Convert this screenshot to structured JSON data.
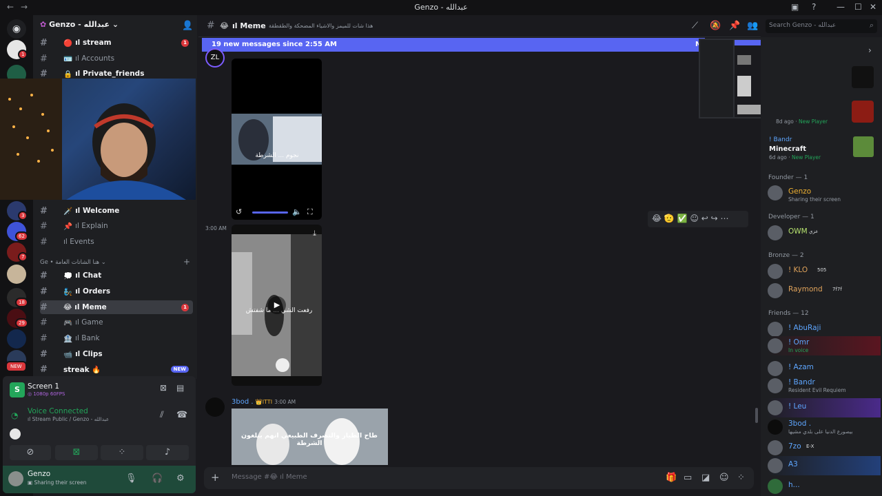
{
  "window": {
    "title": "Genzo - عبدالله"
  },
  "search": {
    "placeholder": "Search Genzo - عبدالله"
  },
  "guild": {
    "name": "Genzo - عبدالله"
  },
  "server_badges": [
    "1",
    "3",
    "62",
    "7",
    "18",
    "29",
    "NEW"
  ],
  "channels_top": [
    {
      "name": "stream",
      "emoji": "🔴",
      "unread": true,
      "count": "1"
    },
    {
      "name": "Accounts",
      "emoji": "🪪",
      "unread": false
    },
    {
      "name": "Private_friends",
      "emoji": "🔒",
      "unread": true
    }
  ],
  "channels_mid": [
    {
      "name": "Welcome",
      "emoji": "🗡️",
      "unread": true
    },
    {
      "name": "Explain",
      "emoji": "📌",
      "unread": false
    },
    {
      "name": "Events",
      "emoji": "",
      "unread": false
    }
  ],
  "category": {
    "name": "Ge • هنا الشاتات العامة"
  },
  "channels_bottom": [
    {
      "name": "Chat",
      "emoji": "💭",
      "unread": true
    },
    {
      "name": "Orders",
      "emoji": "🧞",
      "unread": true
    },
    {
      "name": "Meme",
      "emoji": "😂",
      "active": true,
      "count": "1"
    },
    {
      "name": "Game",
      "emoji": "🎮",
      "unread": false
    },
    {
      "name": "Bank",
      "emoji": "🏦",
      "unread": false
    },
    {
      "name": "Clips",
      "emoji": "📹",
      "unread": true
    },
    {
      "name": "streak",
      "emoji": "🔥",
      "unread": true,
      "badge": "NEW"
    }
  ],
  "stream_panel": {
    "title": "Screen 1",
    "quality": "1080p 60FPS"
  },
  "voice": {
    "status": "Voice Connected",
    "channel": "Stream Public / Genzo - عبدالله"
  },
  "user": {
    "name": "Genzo",
    "status": "Sharing their screen"
  },
  "chat_header": {
    "channel": "ıl Meme",
    "emoji": "😂",
    "topic": "هذا شات للميمز والاشياء المضحكة والطقطقة"
  },
  "banner": {
    "text": "19 new messages since 2:55 AM",
    "mark_label": "M"
  },
  "messages": [
    {
      "time": "3:00 AM"
    },
    {
      "author": "3bod .",
      "tag": "ITTI",
      "time": "3:00 AM",
      "caption": "طاح الطيار والتصرف الطبيعي انهم يبلغون الشرطة"
    }
  ],
  "video1_caption": "نجوم ... الشرطة",
  "video2_caption": "رفعت الشي ... ما شفتش",
  "reactions": [
    "😂",
    "🫡",
    "✅"
  ],
  "composer": {
    "placeholder": "Message #😂 ıl Meme"
  },
  "activity": [
    {
      "ago": "8d ago",
      "tag": "New Player"
    },
    {
      "name": "! Bandr",
      "game": "Minecraft",
      "ago": "6d ago",
      "tag": "New Player"
    }
  ],
  "member_groups": [
    {
      "label": "Founder — 1",
      "members": [
        {
          "name": "Genzo",
          "status": "Sharing their screen",
          "color": "#f0b232"
        }
      ]
    },
    {
      "label": "Developer — 1",
      "members": [
        {
          "name": "OWM",
          "status": "",
          "color": "#b7e36f",
          "tag": "عزي"
        }
      ]
    },
    {
      "label": "Bronze — 2",
      "members": [
        {
          "name": "! KLO",
          "status": "",
          "color": "#e0a35b",
          "tag": "505"
        },
        {
          "name": "Raymond",
          "status": "",
          "color": "#e0a35b",
          "tag": "7f7f"
        }
      ]
    },
    {
      "label": "Friends — 12",
      "members": [
        {
          "name": "! AbuRaji",
          "status": "",
          "color": "#5ea6ff"
        },
        {
          "name": "! Omr",
          "status": "In voice",
          "color": "#5ea6ff",
          "tag": "7f7f"
        },
        {
          "name": "! Azam",
          "status": "",
          "color": "#5ea6ff"
        },
        {
          "name": "! Bandr",
          "status": "Resident Evil Requiem",
          "color": "#5ea6ff"
        },
        {
          "name": "! Leu",
          "status": "",
          "color": "#5ea6ff"
        },
        {
          "name": "3bod .",
          "status": "بيصورع الدنيا على بلدي مشيها",
          "color": "#5ea6ff",
          "tag": "ITTI"
        },
        {
          "name": "7zo",
          "status": "",
          "color": "#5ea6ff",
          "tag": "E-X"
        },
        {
          "name": "A3",
          "status": "",
          "color": "#5ea6ff"
        },
        {
          "name": "h...",
          "status": "",
          "color": "#5ea6ff"
        }
      ]
    }
  ],
  "colors": {
    "accent": "#5865f2",
    "online": "#23a55a",
    "danger": "#da373c"
  }
}
